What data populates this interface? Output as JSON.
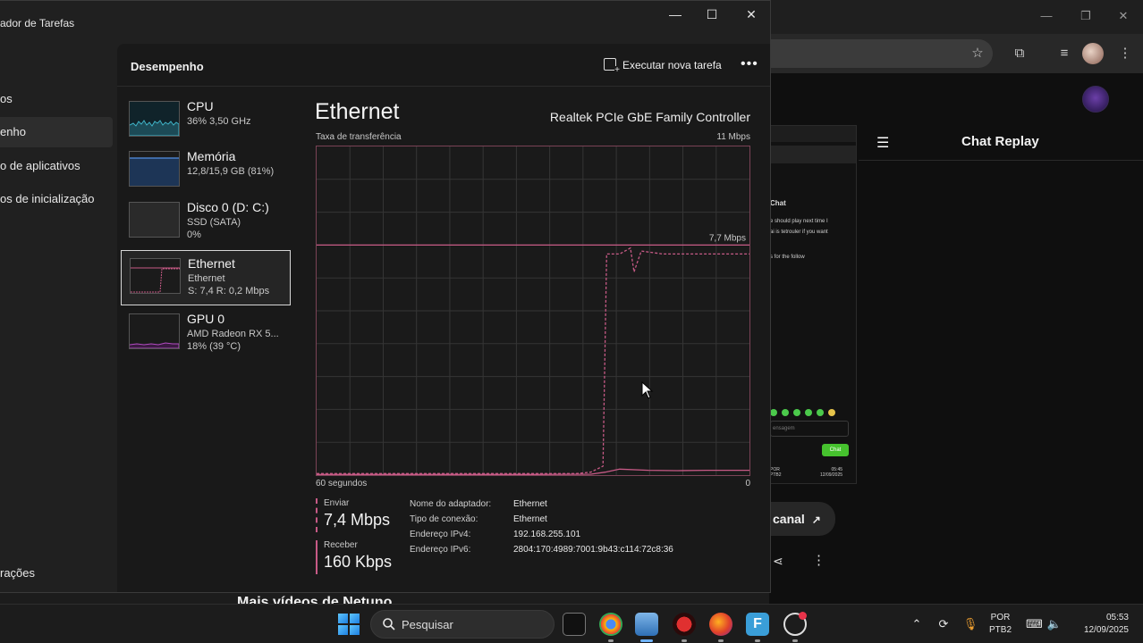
{
  "taskmgr": {
    "title": "ador de Tarefas",
    "window_buttons": {
      "minimize": "—",
      "maximize": "☐",
      "close": "✕"
    },
    "nav": [
      {
        "label": "os"
      },
      {
        "label": "enho"
      },
      {
        "label": "o de aplicativos"
      },
      {
        "label": "os de inicialização"
      },
      {
        "label": "rações"
      }
    ],
    "header": {
      "title": "Desempenho",
      "run_task": "Executar nova tarefa",
      "more": "•••"
    },
    "perf_list": [
      {
        "name": "CPU",
        "sub1": "36% 3,50 GHz",
        "sub2": ""
      },
      {
        "name": "Memória",
        "sub1": "12,8/15,9 GB (81%)",
        "sub2": ""
      },
      {
        "name": "Disco 0 (D: C:)",
        "sub1": "SSD (SATA)",
        "sub2": "0%"
      },
      {
        "name": "Ethernet",
        "sub1": "Ethernet",
        "sub2": "S: 7,4 R: 0,2 Mbps"
      },
      {
        "name": "GPU 0",
        "sub1": "AMD Radeon RX 5...",
        "sub2": "18% (39 °C)"
      }
    ],
    "detail": {
      "title": "Ethernet",
      "controller": "Realtek PCIe GbE Family Controller",
      "rate_label": "Taxa de transferência",
      "rate_max": "11 Mbps",
      "line_label": "7,7 Mbps",
      "time_label": "60 segundos",
      "zero_label": "0",
      "send_label": "Enviar",
      "send_value": "7,4 Mbps",
      "recv_label": "Receber",
      "recv_value": "160 Kbps",
      "props": [
        {
          "key": "Nome do adaptador:",
          "value": "Ethernet"
        },
        {
          "key": "Tipo de conexão:",
          "value": "Ethernet"
        },
        {
          "key": "Endereço IPv4:",
          "value": "192.168.255.101"
        },
        {
          "key": "Endereço IPv6:",
          "value": "2804:170:4989:7001:9b43:c114:72c8:36"
        }
      ]
    }
  },
  "chart_data": {
    "type": "line",
    "xlabel": "60 segundos",
    "ylabel": "Taxa de transferência",
    "xlim": [
      0,
      60
    ],
    "ylim": [
      0,
      11
    ],
    "ylim_units": "Mbps",
    "reference_line": 7.7,
    "grid": true,
    "series": [
      {
        "name": "Enviar",
        "style": "dashed",
        "color": "#c75a86",
        "x": [
          0,
          6,
          12,
          18,
          24,
          30,
          36,
          38,
          39.7,
          40.2,
          42,
          43.5,
          44,
          45,
          48,
          52,
          56,
          60
        ],
        "y": [
          0.05,
          0.05,
          0.05,
          0.05,
          0.05,
          0.05,
          0.05,
          0.1,
          0.3,
          7.4,
          7.4,
          7.6,
          6.8,
          7.5,
          7.4,
          7.4,
          7.4,
          7.4
        ]
      },
      {
        "name": "Receber",
        "style": "solid",
        "color": "#c75a86",
        "x": [
          0,
          10,
          20,
          30,
          38,
          40,
          42,
          46,
          50,
          54,
          58,
          60
        ],
        "y": [
          0.02,
          0.02,
          0.02,
          0.02,
          0.03,
          0.1,
          0.2,
          0.16,
          0.15,
          0.16,
          0.16,
          0.16
        ]
      }
    ]
  },
  "browser": {
    "chat_replay_title": "Chat Replay",
    "thumb_chat_title": "Chat",
    "thumb_lines": [
      "e should play next time I",
      "ai is tetrouler if you want",
      "s for the follow"
    ],
    "thumb_input": "ensagem",
    "thumb_chat_btn": "Chat",
    "thumb_tray": "POR\nPTB2",
    "thumb_clock": "05:45\n12/09/2025",
    "canal_label": "canal",
    "more_videos": "Mais vídeos de Netuno"
  },
  "taskbar": {
    "search_placeholder": "Pesquisar",
    "lang_line1": "POR",
    "lang_line2": "PTB2",
    "time": "05:53",
    "date": "12/09/2025"
  },
  "colors": {
    "accent": "#c75a86",
    "cpu_graph": "#3fb4c8",
    "memory_graph": "#4b7fc8",
    "gpu_graph": "#b14cc0",
    "chat_green": "#46c22e"
  }
}
